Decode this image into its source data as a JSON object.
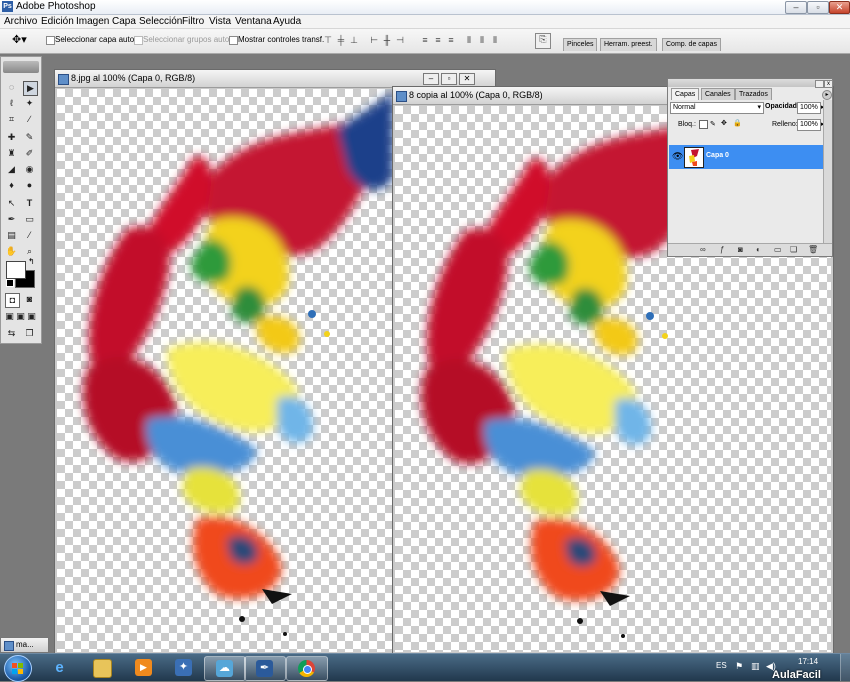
{
  "app": {
    "title": "Adobe Photoshop"
  },
  "menu": [
    "Archivo",
    "Edición",
    "Imagen",
    "Capa",
    "Selección",
    "Filtro",
    "Vista",
    "Ventana",
    "Ayuda"
  ],
  "options": {
    "auto_select_layer": "Seleccionar capa autom.",
    "auto_select_groups": "Seleccionar grupos autom.",
    "show_transform": "Mostrar controles transf.",
    "dock_tabs": [
      "Pinceles",
      "Herram. preest.",
      "Comp. de capas"
    ]
  },
  "documents": [
    {
      "title": "8.jpg al 100% (Capa 0, RGB/8)"
    },
    {
      "title": "8 copia al 100% (Capa 0, RGB/8)"
    }
  ],
  "minimized_doc": {
    "label": "ma..."
  },
  "layers_panel": {
    "tabs": [
      "Capas",
      "Canales",
      "Trazados"
    ],
    "blend_mode": "Normal",
    "opacity_label": "Opacidad:",
    "opacity_value": "100%",
    "lock_label": "Bloq.:",
    "fill_label": "Relleno:",
    "fill_value": "100%",
    "layers": [
      {
        "name": "Capa 0",
        "selected": true
      }
    ]
  },
  "taskbar": {
    "language": "ES",
    "time": "17:14",
    "watermark": "AulaFacil"
  },
  "colors": {
    "selection_blue": "#3d8ef2",
    "taskbar_top": "#4a6b86",
    "taskbar_bottom": "#21384d",
    "workspace": "#7a7a7a"
  },
  "icons": {
    "tools": [
      "marquee-icon",
      "move-icon",
      "lasso-icon",
      "magic-wand-icon",
      "crop-icon",
      "slice-icon",
      "healing-icon",
      "brush-icon",
      "stamp-icon",
      "history-brush-icon",
      "eraser-icon",
      "bucket-icon",
      "blur-icon",
      "dodge-icon",
      "path-select-icon",
      "type-icon",
      "pen-icon",
      "shape-icon",
      "notes-icon",
      "eyedropper-icon",
      "hand-icon",
      "zoom-icon"
    ]
  }
}
